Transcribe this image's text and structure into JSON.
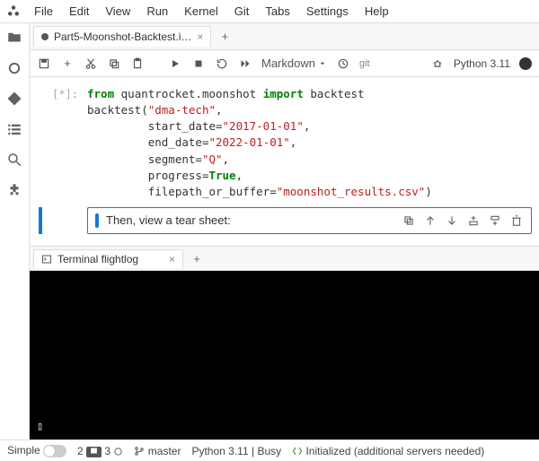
{
  "menu": {
    "items": [
      "File",
      "Edit",
      "View",
      "Run",
      "Kernel",
      "Git",
      "Tabs",
      "Settings",
      "Help"
    ]
  },
  "rail": {
    "icons": [
      "folder",
      "circle",
      "diamond",
      "list",
      "search",
      "puzzle"
    ]
  },
  "tab": {
    "title": "Part5-Moonshot-Backtest.i…"
  },
  "toolbar": {
    "celltype": "Markdown",
    "git_label": "git",
    "kernel": "Python 3.11"
  },
  "code": {
    "prompt": "[*]:",
    "l1a": "from",
    "l1b": "quantrocket.moonshot",
    "l1c": "import",
    "l1d": "backtest",
    "l2a": "backtest(",
    "l2b": "\"dma-tech\"",
    "l2c": ",",
    "l3a": "start_date",
    "l3b": "=",
    "l3c": "\"2017-01-01\"",
    "l3d": ",",
    "l4a": "end_date",
    "l4b": "=",
    "l4c": "\"2022-01-01\"",
    "l4d": ",",
    "l5a": "segment",
    "l5b": "=",
    "l5c": "\"Q\"",
    "l5d": ",",
    "l6a": "progress",
    "l6b": "=",
    "l6c": "True",
    "l6d": ",",
    "l7a": "filepath_or_buffer",
    "l7b": "=",
    "l7c": "\"moonshot_results.csv\"",
    "l7d": ")"
  },
  "md": {
    "text": "Then, view a tear sheet:"
  },
  "term": {
    "title": "Terminal flightlog",
    "prompt": "▯"
  },
  "status": {
    "simple": "Simple",
    "n1": "2",
    "n2": "3",
    "branch": "master",
    "kernel": "Python 3.11",
    "state": "Busy",
    "init": "Initialized (additional servers needed)"
  }
}
